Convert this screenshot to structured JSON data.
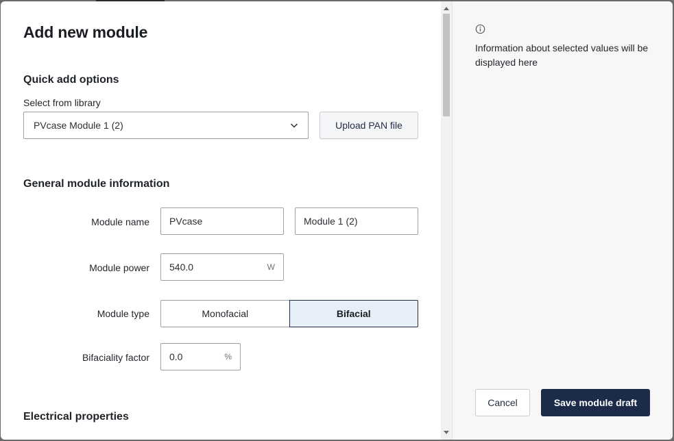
{
  "dialog": {
    "title": "Add new module",
    "quick_add": {
      "heading": "Quick add options",
      "library_label": "Select from library",
      "library_selected": "PVcase Module 1 (2)",
      "upload_label": "Upload PAN file"
    },
    "general": {
      "heading": "General module information",
      "module_name_label": "Module name",
      "module_name_manufacturer": "PVcase",
      "module_name_model": "Module 1 (2)",
      "module_power_label": "Module power",
      "module_power_value": "540.0",
      "module_power_unit": "W",
      "module_type_label": "Module type",
      "module_type_options": [
        "Monofacial",
        "Bifacial"
      ],
      "module_type_selected": "Bifacial",
      "bifaciality_label": "Bifaciality factor",
      "bifaciality_value": "0.0",
      "bifaciality_unit": "%"
    },
    "electrical": {
      "heading": "Electrical properties"
    }
  },
  "info_panel": {
    "icon": "info-icon",
    "text": "Information about selected values will be displayed here"
  },
  "footer": {
    "cancel_label": "Cancel",
    "save_label": "Save module draft"
  },
  "colors": {
    "primary": "#1c2b4a",
    "selected_bg": "#e6eef7",
    "panel_bg": "#f7f7f7"
  }
}
